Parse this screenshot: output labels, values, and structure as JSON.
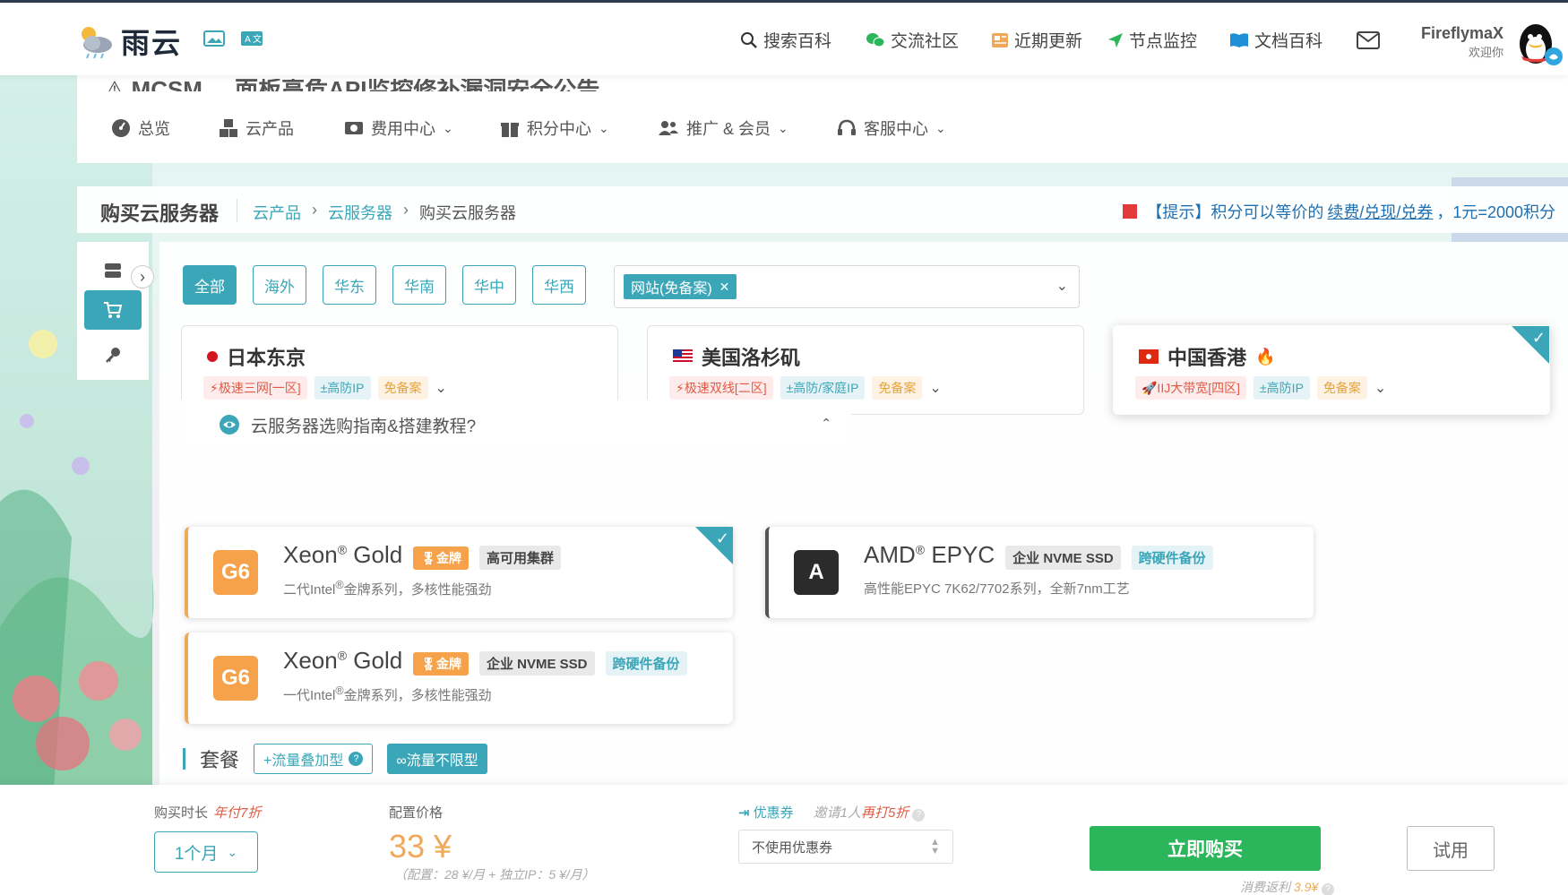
{
  "header": {
    "logo_text": "雨云",
    "nav": [
      {
        "label": "搜索百科",
        "icon": "search-icon"
      },
      {
        "label": "交流社区",
        "icon": "wechat-icon"
      },
      {
        "label": "近期更新",
        "icon": "news-icon"
      },
      {
        "label": "节点监控",
        "icon": "navigation-icon"
      },
      {
        "label": "文档百科",
        "icon": "book-icon"
      }
    ],
    "user": {
      "name": "FireflymaX",
      "welcome": "欢迎你"
    }
  },
  "subnav": {
    "ghost_text": "⚠ MCSM ... 面板高危API监控修补漏洞安全公告",
    "items": [
      {
        "label": "总览",
        "icon": "dashboard-icon",
        "dropdown": false
      },
      {
        "label": "云产品",
        "icon": "cubes-icon",
        "dropdown": false
      },
      {
        "label": "费用中心",
        "icon": "money-icon",
        "dropdown": true
      },
      {
        "label": "积分中心",
        "icon": "gift-icon",
        "dropdown": true
      },
      {
        "label": "推广 & 会员",
        "icon": "users-icon",
        "dropdown": true
      },
      {
        "label": "客服中心",
        "icon": "headset-icon",
        "dropdown": true
      }
    ]
  },
  "breadcrumb": {
    "page_title": "购买云服务器",
    "crumbs": [
      "云产品",
      "云服务器",
      "购买云服务器"
    ],
    "tip_prefix": "【提示】积分可以等价的",
    "tip_link": "续费/兑现/兑券",
    "tip_suffix": "，1元=2000积分"
  },
  "regions": {
    "buttons": [
      "全部",
      "海外",
      "华东",
      "华南",
      "华中",
      "华西"
    ],
    "active": "全部",
    "filter_tag": "网站(免备案)"
  },
  "locations": [
    {
      "name": "日本东京",
      "flag": "japan-flag-icon",
      "tags": [
        "⚡极速三网[一区]",
        "±高防IP",
        "免备案"
      ],
      "selected": false
    },
    {
      "name": "美国洛杉矶",
      "flag": "usa-flag-icon",
      "tags": [
        "⚡极速双线[二区]",
        "±高防/家庭IP",
        "免备案"
      ],
      "selected": false
    },
    {
      "name": "中国香港",
      "flag": "hongkong-flag-icon",
      "hot": "🔥",
      "tags": [
        "🚀IIJ大带宽[四区]",
        "±高防IP",
        "免备案"
      ],
      "selected": true
    }
  ],
  "guide": {
    "label": "云服务器选购指南&搭建教程?"
  },
  "cpus": [
    {
      "badge": "G6",
      "brand": "Xeon",
      "reg": "®",
      "model": "Gold",
      "medal": "🎖金牌",
      "feature": "高可用集群",
      "feature2": "",
      "desc_pre": "二代Intel",
      "desc_reg": "®",
      "desc_post": "金牌系列，多核性能强劲",
      "selected": true
    },
    {
      "badge": "A",
      "brand": "AMD",
      "reg": "®",
      "model": "EPYC",
      "feature": "企业 NVME SSD",
      "feature2": "跨硬件备份",
      "desc": "高性能EPYC 7K62/7702系列，全新7nm工艺",
      "selected": false
    },
    {
      "badge": "G6",
      "brand": "Xeon",
      "reg": "®",
      "model": "Gold",
      "medal": "🎖金牌",
      "feature": "企业 NVME SSD",
      "feature2": "跨硬件备份",
      "desc_pre": "一代Intel",
      "desc_reg": "®",
      "desc_post": "金牌系列，多核性能强劲",
      "selected": false
    }
  ],
  "package": {
    "title": "套餐",
    "options": [
      {
        "label": "+流量叠加型",
        "help": "?"
      },
      {
        "label": "∞流量不限型"
      }
    ]
  },
  "bottom": {
    "duration_label": "购买时长",
    "duration_promo": "年付7折",
    "duration_value": "1个月",
    "price_label": "配置价格",
    "price": "33 ¥",
    "price_detail": "（配置：28 ¥/月 + 独立IP：5 ¥/月）",
    "coupon_label": "优惠券",
    "coupon_invite": "邀请1人",
    "coupon_invite_promo": "再打5折",
    "coupon_value": "不使用优惠券",
    "buy_label": "立即购买",
    "trial_label": "试用",
    "rebate_prefix": "消费返利",
    "rebate_value": "3.9¥"
  },
  "colors": {
    "accent": "#3aa6b8",
    "buy": "#2bb65b",
    "price": "#f0a95a",
    "promo": "#e05a45"
  }
}
